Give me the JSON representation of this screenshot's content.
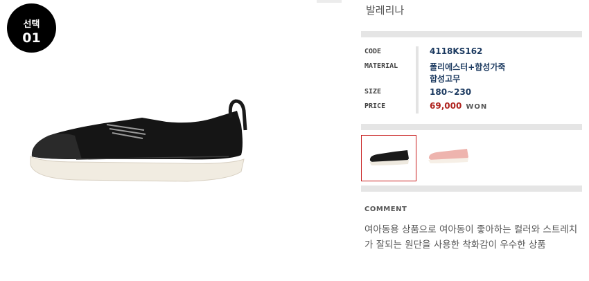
{
  "badge": {
    "line1": "선택",
    "line2": "01"
  },
  "product": {
    "name": "발레리나"
  },
  "specs": {
    "code_label": "CODE",
    "code_value": "4118KS162",
    "material_label": "MATERIAL",
    "material_value_1": "폴리에스터+합성가죽",
    "material_value_2": "합성고무",
    "size_label": "SIZE",
    "size_value": "180~230",
    "price_label": "PRICE",
    "price_value": "69,000",
    "price_unit": "WON"
  },
  "thumbnails": [
    {
      "color": "black",
      "selected": true
    },
    {
      "color": "pink",
      "selected": false
    }
  ],
  "comment": {
    "title": "COMMENT",
    "text": "여아동용 상품으로 여아동이 좋아하는 컬러와 스트레치가 잘되는 원단을 사용한 착화감이 우수한 상품"
  },
  "colors": {
    "price": "#b0241f",
    "value": "#1c3a60",
    "selected_border": "#c81c1c"
  }
}
